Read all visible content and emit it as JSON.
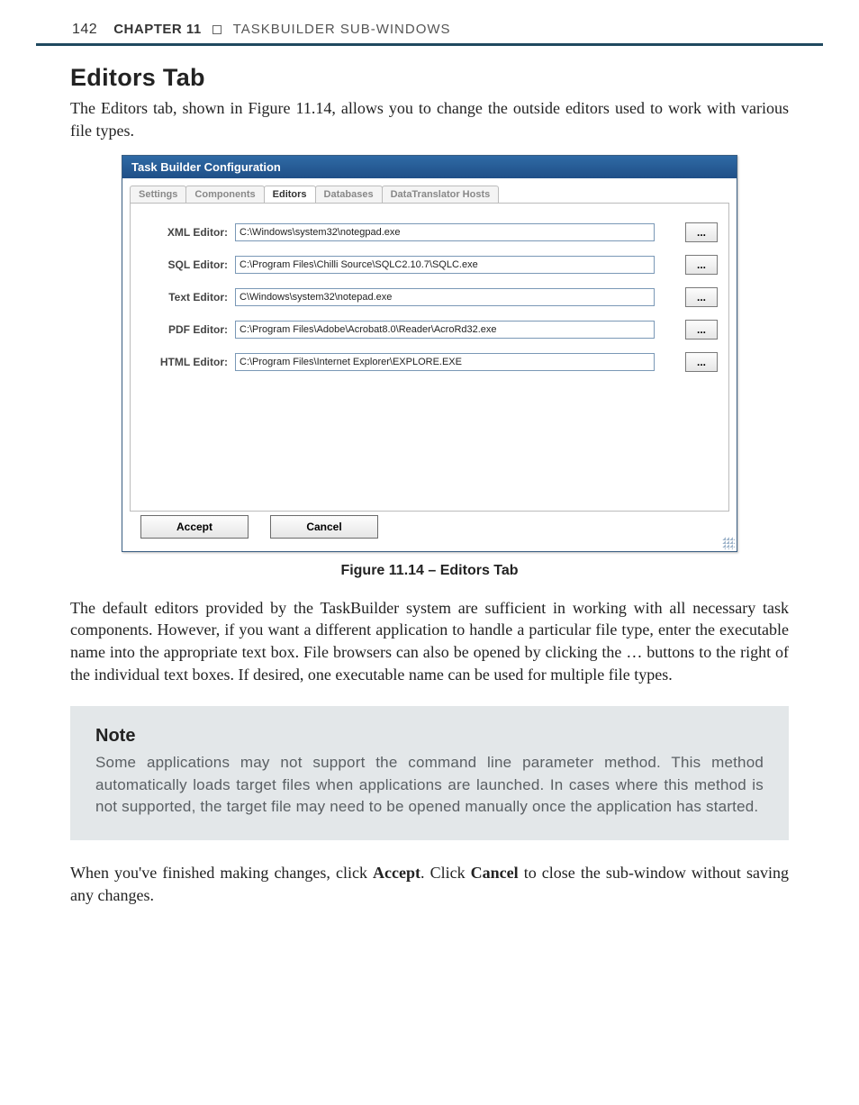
{
  "header": {
    "page_no": "142",
    "chapter_label": "CHAPTER 11",
    "chapter_title": "TASKBUILDER SUB-WINDOWS"
  },
  "section": {
    "title": "Editors Tab",
    "intro": "The Editors tab, shown in Figure 11.14, allows you to change the outside editors used to work with various file types."
  },
  "window": {
    "title": "Task Builder Configuration",
    "tabs": [
      "Settings",
      "Components",
      "Editors",
      "Databases",
      "DataTranslator Hosts"
    ],
    "active_tab_index": 2,
    "rows": [
      {
        "label": "XML Editor:",
        "value": "C:\\Windows\\system32\\notegpad.exe"
      },
      {
        "label": "SQL Editor:",
        "value": "C:\\Program Files\\Chilli Source\\SQLC2.10.7\\SQLC.exe"
      },
      {
        "label": "Text Editor:",
        "value": "C\\Windows\\system32\\notepad.exe"
      },
      {
        "label": "PDF Editor:",
        "value": "C:\\Program Files\\Adobe\\Acrobat8.0\\Reader\\AcroRd32.exe"
      },
      {
        "label": "HTML Editor:",
        "value": "C:\\Program Files\\Internet Explorer\\EXPLORE.EXE"
      }
    ],
    "browse_label": "...",
    "accept_label": "Accept",
    "cancel_label": "Cancel"
  },
  "caption": "Figure 11.14 – Editors Tab",
  "para_after_figure": "The default editors provided by the TaskBuilder system are sufficient in working with all necessary task components. However, if you want a different application to handle a particular file type, enter the executable name into the appropriate text box. File browsers can also be opened by clicking the … buttons to the right of the individual text boxes. If desired, one executable name can be used for multiple file types.",
  "note": {
    "title": "Note",
    "body": "Some applications may not support the command line parameter method. This method automatically loads target files when applications are launched. In cases where this method is not supported, the target file may need to be opened manually once the application has started."
  },
  "closing_prefix": "When you've finished making changes, click ",
  "closing_bold1": "Accept",
  "closing_mid": ". Click ",
  "closing_bold2": "Cancel",
  "closing_suffix": " to close the sub-window without saving any changes."
}
